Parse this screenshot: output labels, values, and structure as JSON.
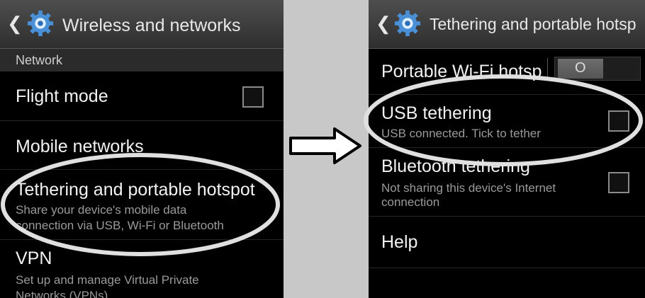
{
  "left": {
    "title": "Wireless and networks",
    "section": "Network",
    "items": [
      {
        "title": "Flight mode",
        "checked": false
      },
      {
        "title": "Mobile networks"
      },
      {
        "title": "Tethering and portable hotspot",
        "subtitle_line1": "Share your device's mobile data",
        "subtitle_line2": "connection via USB, Wi-Fi or Bluetooth"
      },
      {
        "title": "VPN",
        "subtitle_line1": "Set up and manage Virtual Private",
        "subtitle_line2": "Networks (VPNs)"
      }
    ]
  },
  "right": {
    "title": "Tethering and portable hotsp",
    "items": [
      {
        "title": "Portable Wi-Fi hotsp",
        "toggle": "O",
        "enabled": false
      },
      {
        "title": "USB tethering",
        "subtitle": "USB connected. Tick to tether",
        "checked": false
      },
      {
        "title": "Bluetooth tethering",
        "subtitle_line1": "Not sharing this device's Internet",
        "subtitle_line2": "connection",
        "checked": false
      },
      {
        "title": "Help"
      }
    ]
  },
  "icons": {
    "back": "chevron-left-icon",
    "settings": "gear-icon",
    "arrow": "right-arrow-icon"
  },
  "colors": {
    "background": "#000000",
    "highlight": "#e0e0e0",
    "separator": "#c8c8c8"
  }
}
